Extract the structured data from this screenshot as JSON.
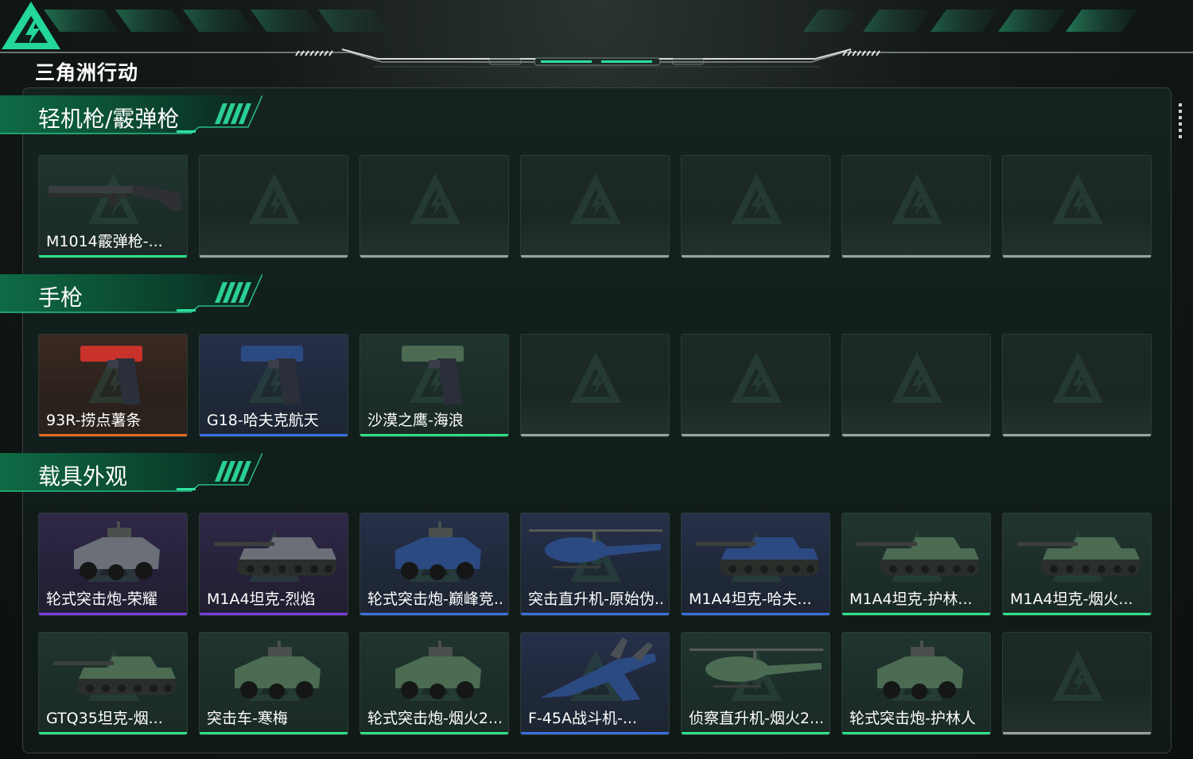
{
  "app": {
    "logo_text": "三角洲行动"
  },
  "colors": {
    "accent": "#2fe0a0",
    "rarity_orange": "#e06a22",
    "rarity_blue": "#3a6fe0",
    "rarity_purple": "#7a3fe0",
    "rarity_green": "#2fe08a",
    "rarity_empty": "#9aa39f"
  },
  "sections": [
    {
      "title": "轻机枪/霰弹枪",
      "rows": [
        [
          {
            "name": "M1014霰弹枪-...",
            "rarity": "green",
            "icon": "shotgun-icon"
          },
          {
            "name": "",
            "rarity": "empty"
          },
          {
            "name": "",
            "rarity": "empty"
          },
          {
            "name": "",
            "rarity": "empty"
          },
          {
            "name": "",
            "rarity": "empty"
          },
          {
            "name": "",
            "rarity": "empty"
          },
          {
            "name": "",
            "rarity": "empty"
          }
        ]
      ]
    },
    {
      "title": "手枪",
      "rows": [
        [
          {
            "name": "93R-捞点薯条",
            "rarity": "orange",
            "icon": "pistol-icon"
          },
          {
            "name": "G18-哈夫克航天",
            "rarity": "blue",
            "icon": "pistol-icon"
          },
          {
            "name": "沙漠之鹰-海浪",
            "rarity": "green",
            "icon": "pistol-icon"
          },
          {
            "name": "",
            "rarity": "empty"
          },
          {
            "name": "",
            "rarity": "empty"
          },
          {
            "name": "",
            "rarity": "empty"
          },
          {
            "name": "",
            "rarity": "empty"
          }
        ]
      ]
    },
    {
      "title": "载具外观",
      "rows": [
        [
          {
            "name": "轮式突击炮-荣耀",
            "rarity": "purple",
            "icon": "armored-car-icon"
          },
          {
            "name": "M1A4坦克-烈焰",
            "rarity": "purple",
            "icon": "tank-icon"
          },
          {
            "name": "轮式突击炮-巅峰竞...",
            "rarity": "blue",
            "icon": "armored-car-icon"
          },
          {
            "name": "突击直升机-原始伪...",
            "rarity": "blue",
            "icon": "helicopter-icon"
          },
          {
            "name": "M1A4坦克-哈夫...",
            "rarity": "blue",
            "icon": "tank-icon"
          },
          {
            "name": "M1A4坦克-护林...",
            "rarity": "green",
            "icon": "tank-icon"
          },
          {
            "name": "M1A4坦克-烟火...",
            "rarity": "green",
            "icon": "tank-icon"
          }
        ],
        [
          {
            "name": "GTQ35坦克-烟...",
            "rarity": "green",
            "icon": "tank-icon"
          },
          {
            "name": "突击车-寒梅",
            "rarity": "green",
            "icon": "armored-car-icon"
          },
          {
            "name": "轮式突击炮-烟火2...",
            "rarity": "green",
            "icon": "armored-car-icon"
          },
          {
            "name": "F-45A战斗机-...",
            "rarity": "blue",
            "icon": "jet-icon"
          },
          {
            "name": "侦察直升机-烟火2...",
            "rarity": "green",
            "icon": "helicopter-icon"
          },
          {
            "name": "轮式突击炮-护林人",
            "rarity": "green",
            "icon": "armored-car-icon"
          },
          {
            "name": "",
            "rarity": "empty"
          }
        ]
      ]
    }
  ]
}
